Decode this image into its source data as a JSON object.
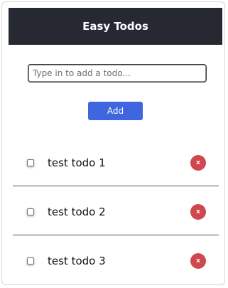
{
  "header": {
    "title": "Easy Todos"
  },
  "input": {
    "value": "",
    "placeholder": "Type in to add a todo..."
  },
  "add_button": {
    "label": "Add"
  },
  "todos": [
    {
      "text": "test todo 1",
      "checked": false,
      "delete_icon": "x"
    },
    {
      "text": "test todo 2",
      "checked": false,
      "delete_icon": "x"
    },
    {
      "text": "test todo 3",
      "checked": false,
      "delete_icon": "x"
    }
  ],
  "colors": {
    "header_bg": "#272932",
    "accent": "#3f66de",
    "delete": "#d0484e"
  }
}
